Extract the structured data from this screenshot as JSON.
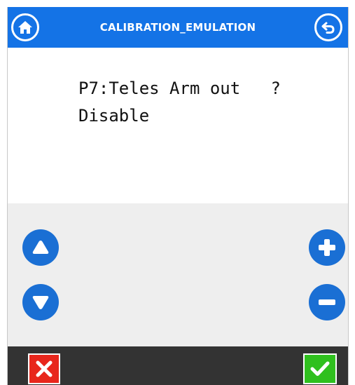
{
  "header": {
    "title": "CALIBRATION_EMULATION",
    "home_icon": "home-icon",
    "back_icon": "back-arrow-icon",
    "color": "#1473e6"
  },
  "display": {
    "line1": "P7:Teles Arm out   ?",
    "line2": "Disable"
  },
  "controls": {
    "up_icon": "triangle-up-icon",
    "down_icon": "triangle-down-icon",
    "plus_icon": "plus-icon",
    "minus_icon": "minus-icon",
    "button_color": "#1a6fd4"
  },
  "footer": {
    "cancel_icon": "x-icon",
    "confirm_icon": "checkmark-icon",
    "cancel_color": "#e8261c",
    "confirm_color": "#2fc01e"
  }
}
